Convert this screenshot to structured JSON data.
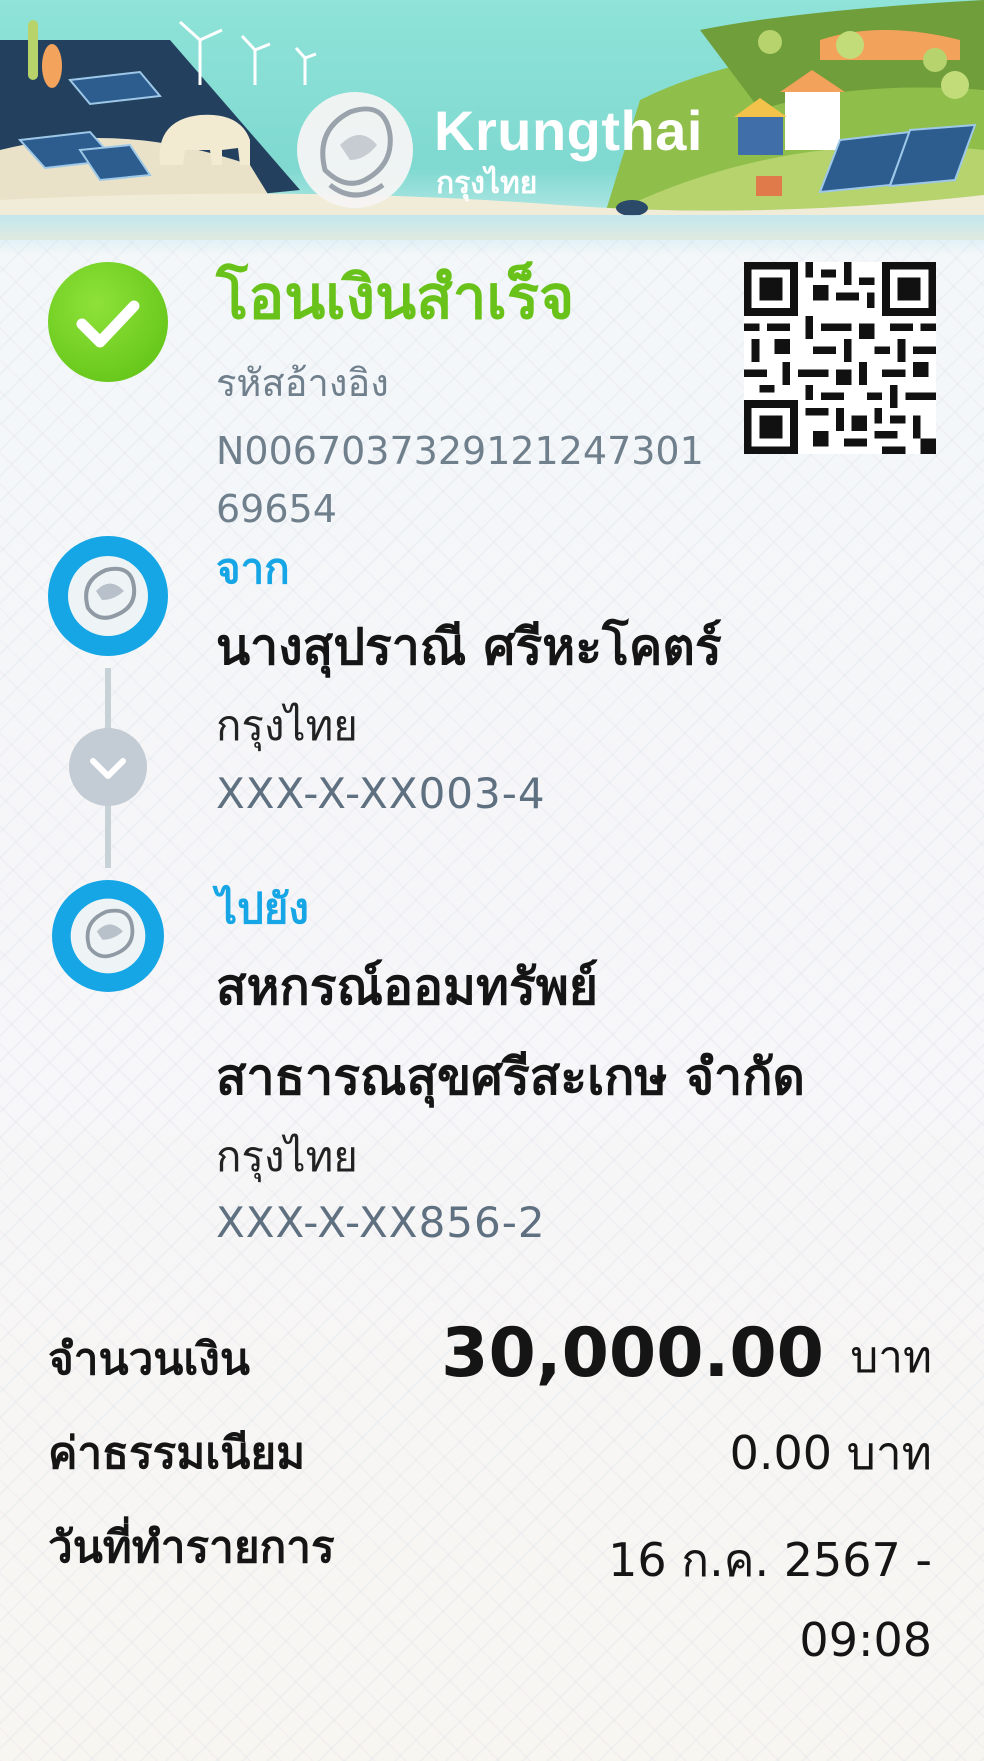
{
  "header": {
    "brand_name": "Krungthai",
    "brand_thai": "กรุงไทย"
  },
  "status": {
    "title": "โอนเงินสำเร็จ",
    "ref_label": "รหัสอ้างอิง",
    "ref_value": "N0067037329121247301 69654"
  },
  "from": {
    "label": "จาก",
    "name": "นางสุปราณี ศรีหะโคตร์",
    "bank": "กรุงไทย",
    "account": "XXX-X-XX003-4"
  },
  "to": {
    "label": "ไปยัง",
    "name_line1": "สหกรณ์ออมทรัพย์",
    "name_line2": "สาธารณสุขศรีสะเกษ จำกัด",
    "bank": "กรุงไทย",
    "account": "XXX-X-XX856-2"
  },
  "summary": {
    "amount_label": "จำนวนเงิน",
    "amount_value": "30,000.00",
    "amount_unit": "บาท",
    "fee_label": "ค่าธรรมเนียม",
    "fee_value": "0.00 บาท",
    "date_label": "วันที่ทำรายการ",
    "date_value": "16 ก.ค. 2567 - 09:08"
  },
  "icons": {
    "success": "check-circle-icon",
    "bank_logo": "krungthai-logo-icon",
    "connector": "chevron-down-icon",
    "qr": "qr-code-icon"
  },
  "colors": {
    "success_green": "#69c21a",
    "brand_blue": "#16a6e6",
    "text_dark": "#151515",
    "text_grey": "#6f7f8c"
  }
}
